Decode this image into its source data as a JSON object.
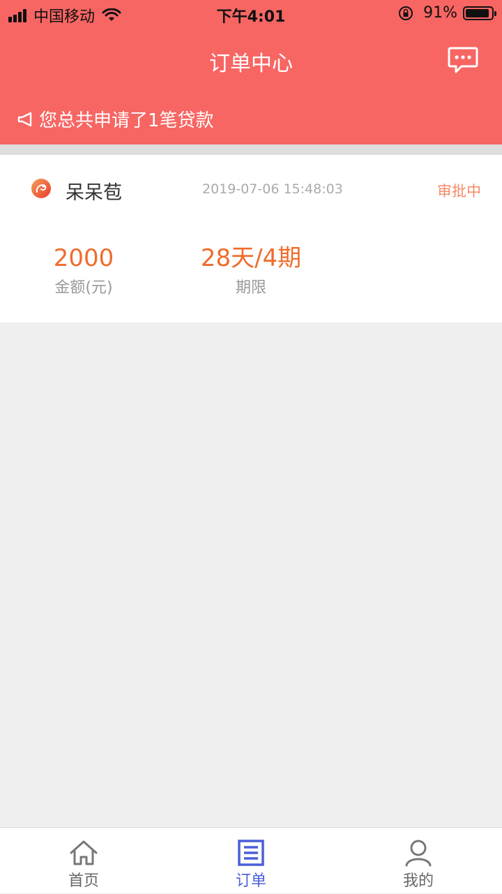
{
  "status_bar": {
    "carrier": "中国移动",
    "time": "下午4:01",
    "battery_percent": "91%",
    "battery_level": 0.91
  },
  "header": {
    "title": "订单中心",
    "notice": "您总共申请了1笔贷款",
    "background": "#f76663"
  },
  "order": {
    "product_name": "呆呆苞",
    "time": "2019-07-06 15:48:03",
    "status": "审批中",
    "amount_value": "2000",
    "amount_label": "金额(元)",
    "term_value": "28天/4期",
    "term_label": "期限"
  },
  "tabs": [
    {
      "label": "首页",
      "icon": "home-icon",
      "active": false
    },
    {
      "label": "订单",
      "icon": "order-list-icon",
      "active": true
    },
    {
      "label": "我的",
      "icon": "user-icon",
      "active": false
    }
  ],
  "colors": {
    "accent_orange": "#ef6c2b",
    "status_orange": "#f48a66",
    "tab_active": "#4a5fd8"
  }
}
